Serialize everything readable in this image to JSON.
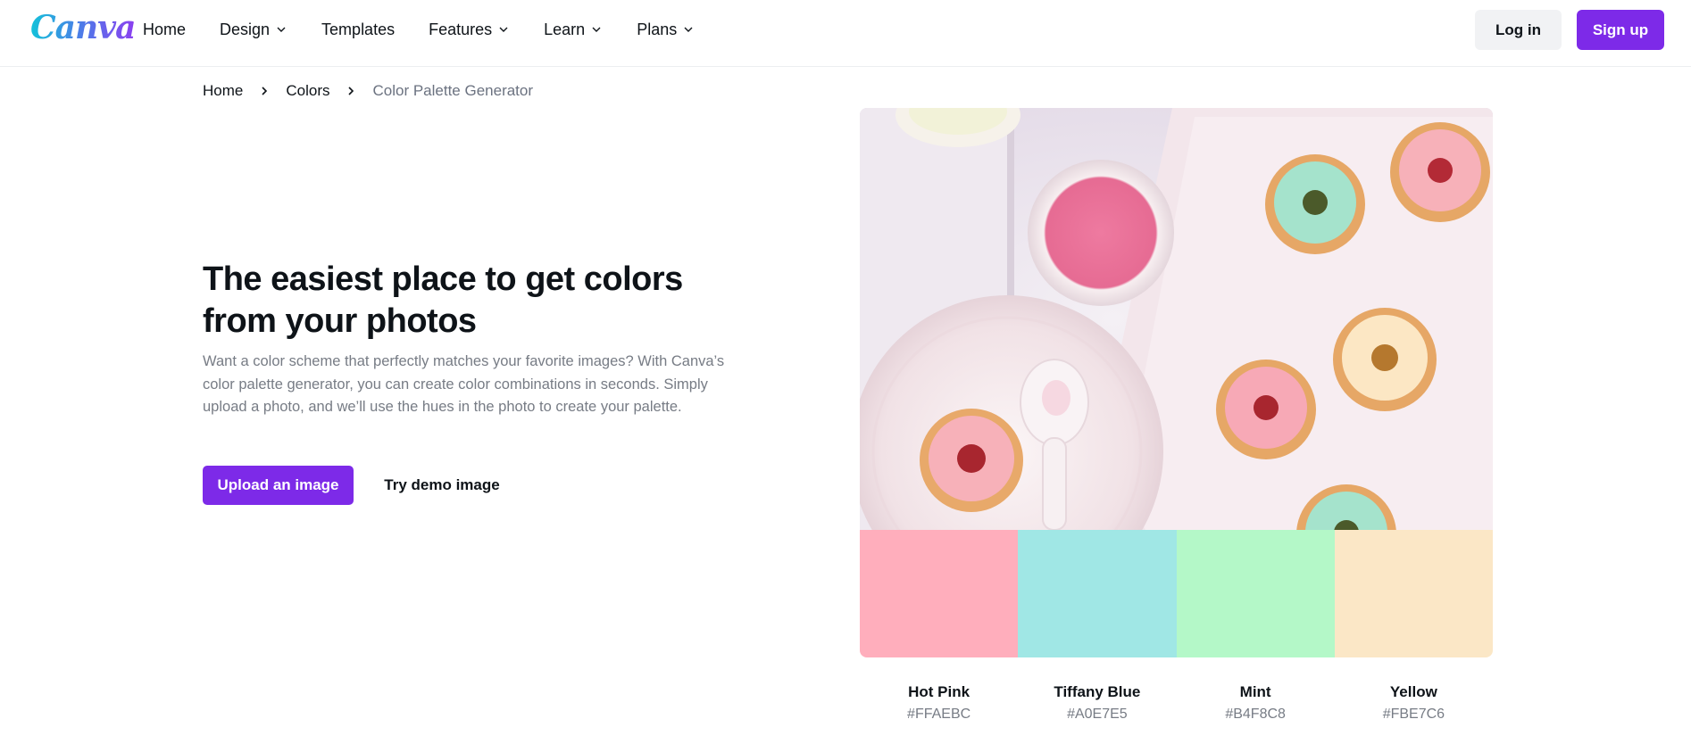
{
  "header": {
    "logo": "Canva",
    "nav": [
      {
        "label": "Home",
        "dropdown": false
      },
      {
        "label": "Design",
        "dropdown": true
      },
      {
        "label": "Templates",
        "dropdown": false
      },
      {
        "label": "Features",
        "dropdown": true
      },
      {
        "label": "Learn",
        "dropdown": true
      },
      {
        "label": "Plans",
        "dropdown": true
      }
    ],
    "login_label": "Log in",
    "signup_label": "Sign up"
  },
  "breadcrumb": [
    "Home",
    "Colors",
    "Color Palette Generator"
  ],
  "hero": {
    "title": "The easiest place to get colors from your photos",
    "description": "Want a color scheme that perfectly matches your favorite images? With Canva’s color palette generator, you can create color combinations in seconds. Simply upload a photo, and we’ll use the hues in the photo to create your palette.",
    "upload_label": "Upload an image",
    "demo_label": "Try demo image"
  },
  "palette": [
    {
      "name": "Hot Pink",
      "hex": "#FFAEBC"
    },
    {
      "name": "Tiffany Blue",
      "hex": "#A0E7E5"
    },
    {
      "name": "Mint",
      "hex": "#B4F8C8"
    },
    {
      "name": "Yellow",
      "hex": "#FBE7C6"
    }
  ],
  "colors": {
    "accent": "#7d2ae8",
    "text": "#0e1318",
    "muted": "#777c85"
  }
}
